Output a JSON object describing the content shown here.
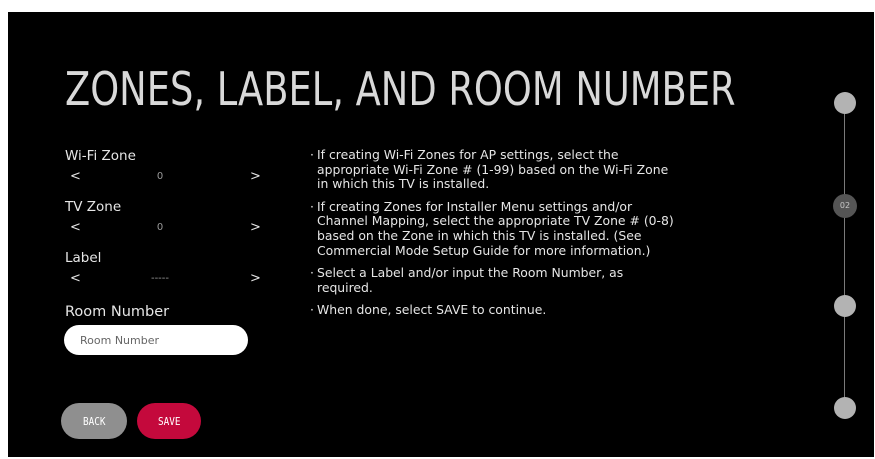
{
  "title": "ZONES, LABEL, AND ROOM NUMBER",
  "fields": {
    "wifi_zone": {
      "label": "Wi-Fi Zone",
      "value": "0"
    },
    "tv_zone": {
      "label": "TV Zone",
      "value": "0"
    },
    "label": {
      "label": "Label",
      "value": "-----"
    }
  },
  "arrows": {
    "prev": "<",
    "next": ">"
  },
  "room_number": {
    "label": "Room Number",
    "placeholder": "Room Number",
    "value": ""
  },
  "buttons": {
    "back": "BACK",
    "save": "SAVE"
  },
  "instructions": [
    "If creating Wi-Fi Zones for AP settings, select the appropriate Wi-Fi Zone # (1-99) based on the Wi-Fi Zone in which this TV is installed.",
    "If creating Zones for Installer Menu settings and/or Channel Mapping, select the appropriate TV Zone # (0-8) based on the Zone in which this TV is installed. (See Commercial Mode Setup Guide for more information.)",
    "Select a Label and/or input the Room Number, as required.",
    "When done, select SAVE to continue."
  ],
  "steps": {
    "active_label": "02",
    "total": 4,
    "current": 2
  },
  "colors": {
    "background": "#000000",
    "save_button": "#c4093c",
    "back_button": "#8f8f8f",
    "step_dot": "#b3b3b3",
    "active_step": "#555555"
  }
}
